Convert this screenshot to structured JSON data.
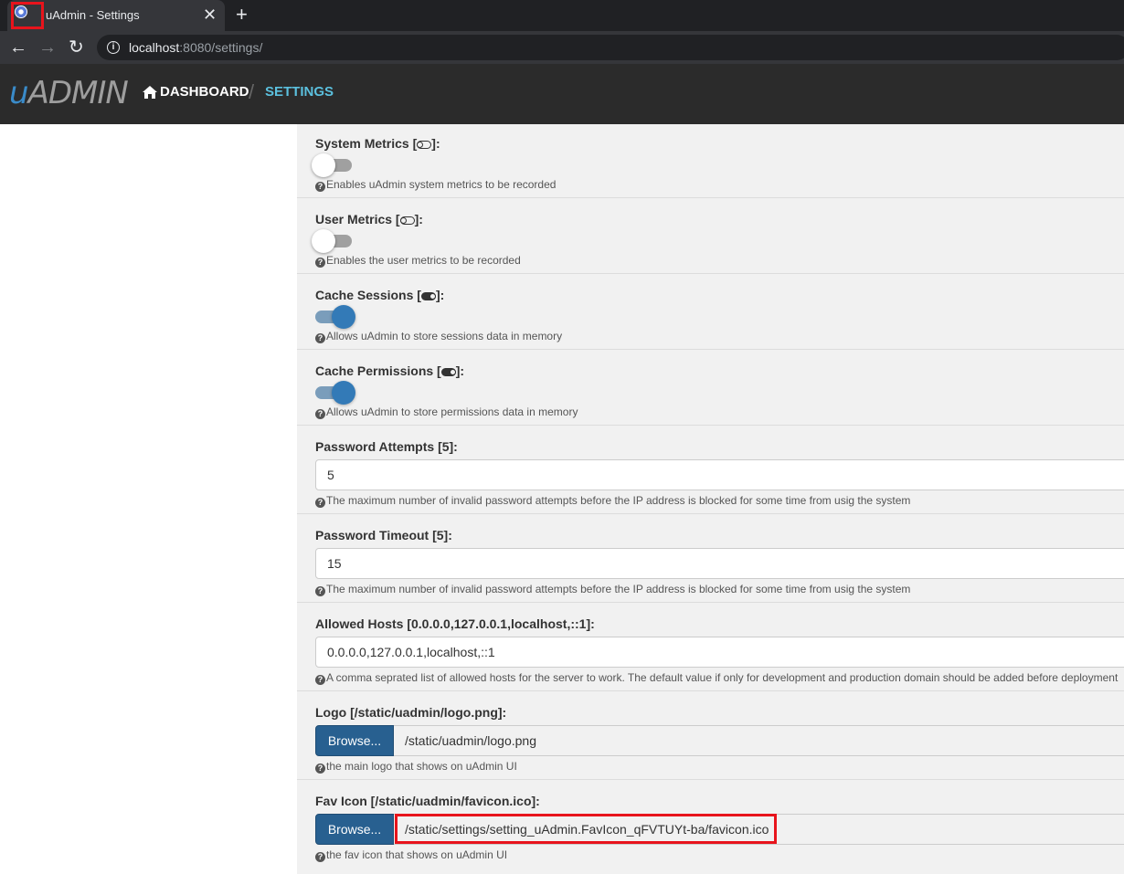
{
  "browser": {
    "tab_title": "uAdmin - Settings",
    "close_glyph": "✕",
    "new_tab_glyph": "+",
    "back_glyph": "←",
    "forward_glyph": "→",
    "reload_glyph": "↻",
    "info_glyph": "i",
    "url_host": "localhost",
    "url_rest": ":8080/settings/"
  },
  "header": {
    "logo_u": "u",
    "logo_rest": "ADMIN",
    "dashboard_label": "DASHBOARD",
    "separator": "/",
    "current_label": "SETTINGS"
  },
  "help_glyph": "?",
  "settings": {
    "system_metrics": {
      "label_prefix": "System Metrics [",
      "label_suffix": "]:",
      "value": false,
      "help": "Enables uAdmin system metrics to be recorded"
    },
    "user_metrics": {
      "label_prefix": "User Metrics [",
      "label_suffix": "]:",
      "value": false,
      "help": "Enables the user metrics to be recorded"
    },
    "cache_sessions": {
      "label_prefix": "Cache Sessions [",
      "label_suffix": "]:",
      "value": true,
      "help": "Allows uAdmin to store sessions data in memory"
    },
    "cache_permissions": {
      "label_prefix": "Cache Permissions [",
      "label_suffix": "]:",
      "value": true,
      "help": "Allows uAdmin to store permissions data in memory"
    },
    "password_attempts": {
      "label": "Password Attempts [5]:",
      "value": "5",
      "help": "The maximum number of invalid password attempts before the IP address is blocked for some time from usig the system"
    },
    "password_timeout": {
      "label": "Password Timeout [5]:",
      "value": "15",
      "help": "The maximum number of invalid password attempts before the IP address is blocked for some time from usig the system"
    },
    "allowed_hosts": {
      "label": "Allowed Hosts [0.0.0.0,127.0.0.1,localhost,::1]:",
      "value": "0.0.0.0,127.0.0.1,localhost,::1",
      "help": "A comma seprated list of allowed hosts for the server to work. The default value if only for development and production domain should be added before deployment"
    },
    "logo": {
      "label": "Logo [/static/uadmin/logo.png]:",
      "browse_label": "Browse...",
      "path": "/static/uadmin/logo.png",
      "help": "the main logo that shows on uAdmin UI"
    },
    "fav_icon": {
      "label": "Fav Icon [/static/uadmin/favicon.ico]:",
      "browse_label": "Browse...",
      "path": "/static/settings/setting_uAdmin.FavIcon_qFVTUYt-ba/favicon.ico",
      "help": "the fav icon that shows on uAdmin UI"
    }
  },
  "colors": {
    "highlight": "#e8141c",
    "primary": "#286090",
    "accent": "#5bc0de"
  }
}
